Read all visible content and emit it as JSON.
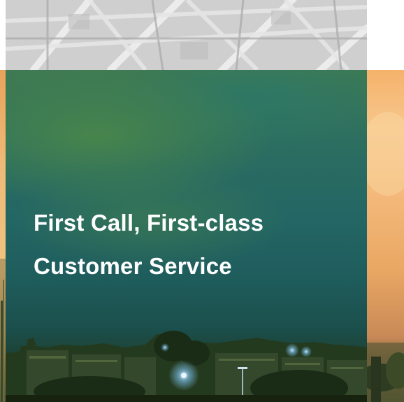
{
  "hero": {
    "title_line_1": "First Call, First-class",
    "title_line_2": "Customer Service"
  },
  "colors": {
    "panel_top": "#3f7a52",
    "panel_mid": "#236664",
    "panel_bottom": "#1b2c1a",
    "title_text": "#ffffff",
    "sunset_orange": "#f5b26b",
    "steel_grey": "#c9c9c9"
  },
  "images": {
    "top_strip": "grey-steel-structure-photo",
    "side_strips": "sunset-cityscape-photo",
    "hero_background": "teal-tinted-city-skyline-photo"
  }
}
